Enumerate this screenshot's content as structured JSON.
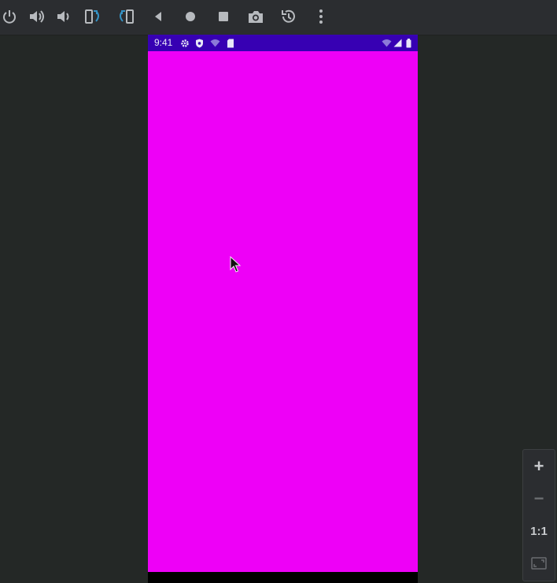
{
  "toolbar": {
    "buttons": [
      {
        "id": "power",
        "icon": "power-icon"
      },
      {
        "id": "volume-up",
        "icon": "volume-up-icon"
      },
      {
        "id": "volume-down",
        "icon": "volume-down-icon"
      },
      {
        "id": "rotate-left",
        "icon": "rotate-left-icon"
      },
      {
        "id": "rotate-right",
        "icon": "rotate-right-icon"
      },
      {
        "id": "back",
        "icon": "back-triangle-icon"
      },
      {
        "id": "home",
        "icon": "home-circle-icon"
      },
      {
        "id": "overview",
        "icon": "overview-square-icon"
      },
      {
        "id": "screenshot",
        "icon": "camera-icon"
      },
      {
        "id": "snapshot",
        "icon": "history-icon"
      },
      {
        "id": "more",
        "icon": "more-vert-icon"
      }
    ]
  },
  "device": {
    "status_bar": {
      "time": "9:41",
      "left_icons": [
        "settings-icon",
        "shield-icon",
        "wifi-icon",
        "sim-card-icon"
      ],
      "right_icons": [
        "wifi-icon",
        "signal-icon",
        "battery-icon"
      ],
      "color": "#3700b3"
    },
    "app_background_color": "#ee00f7"
  },
  "zoom_controls": {
    "zoom_in": "+",
    "zoom_out": "−",
    "actual_size": "1:1",
    "fit_icon": "fit-screen-icon"
  },
  "colors": {
    "toolbar_icon": "#b7babe",
    "accent_blue": "#3592c4",
    "background": "#242826"
  }
}
